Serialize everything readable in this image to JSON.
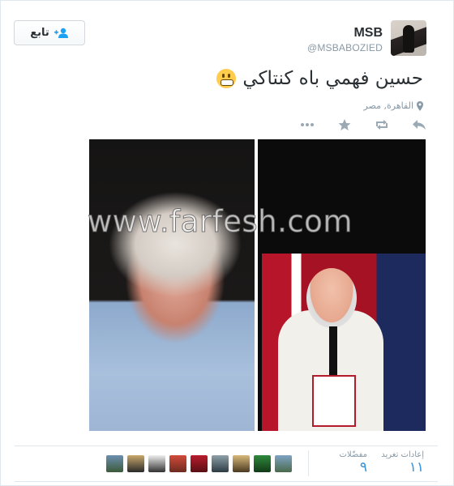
{
  "user": {
    "display_name": "MSB",
    "handle": "@MSBABOZIED"
  },
  "follow_button": {
    "label": "تابع",
    "icon": "follow-user-icon"
  },
  "tweet": {
    "text": "حسين فهمي باه كنتاكي",
    "emoji": "grimacing-face-emoji",
    "location": "القاهرة, مصر",
    "location_icon": "map-pin-icon"
  },
  "actions": [
    {
      "name": "reply",
      "icon": "reply-icon"
    },
    {
      "name": "retweet",
      "icon": "retweet-icon"
    },
    {
      "name": "favorite",
      "icon": "star-icon"
    },
    {
      "name": "more",
      "icon": "more-dots-icon"
    }
  ],
  "media": {
    "watermark": "www.farfesh.com"
  },
  "stats": {
    "retweets_label": "إعادات تغريد",
    "retweets_value": "١١",
    "favorites_label": "مفضّلات",
    "favorites_value": "٩"
  },
  "favoriter_avatars_count": 10,
  "colors": {
    "link_blue": "#3b94d9",
    "muted_gray": "#8899a6",
    "text_dark": "#292f33",
    "border": "#e1e8ed"
  }
}
